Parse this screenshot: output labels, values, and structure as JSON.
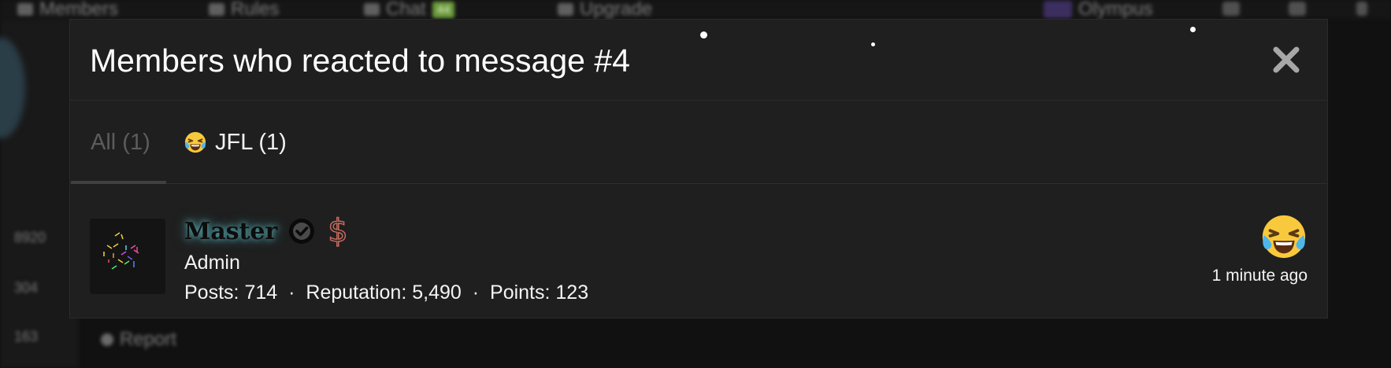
{
  "background": {
    "nav": {
      "members": "Members",
      "rules": "Rules",
      "chat": "Chat",
      "chat_badge": "44",
      "upgrade": "Upgrade",
      "user": "Olympus"
    },
    "side_numbers": [
      "8920",
      "304",
      "163"
    ],
    "report_label": "Report"
  },
  "modal": {
    "title": "Members who reacted to message #4",
    "close_icon": "close-icon",
    "tabs": [
      {
        "label": "All (1)",
        "active": true
      },
      {
        "label": "JFL (1)",
        "icon": "laughing-crying-emoji",
        "active": false
      }
    ],
    "member": {
      "name": "Master",
      "verified_icon": "check-circle-icon",
      "badge_icon": "dollar-icon",
      "role": "Admin",
      "stats": {
        "posts_label": "Posts:",
        "posts": "714",
        "reputation_label": "Reputation:",
        "reputation": "5,490",
        "points_label": "Points:",
        "points": "123"
      },
      "reaction_icon": "laughing-crying-emoji",
      "time": "1 minute ago"
    }
  },
  "colors": {
    "modal_bg": "#1f1f1f",
    "page_bg": "#111111",
    "text": "#ffffff",
    "muted_tab": "#5c5c5c",
    "name_glow": "#6edce6",
    "dollar": "#c46a5e"
  }
}
